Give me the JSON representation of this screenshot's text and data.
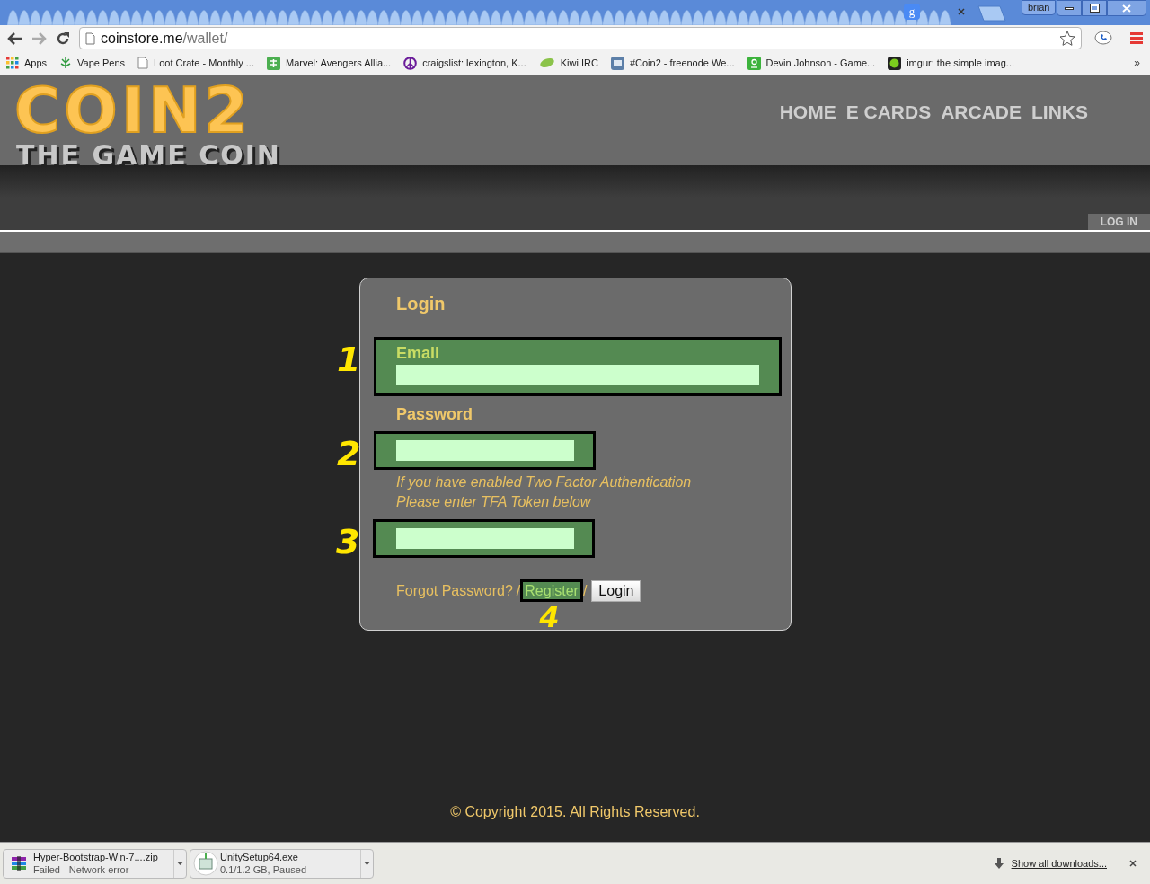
{
  "browser": {
    "tab_favicon": "g",
    "profile": "brian",
    "url": {
      "host": "coinstore.me",
      "path": "/wallet/"
    },
    "bookmarks": [
      {
        "kind": "grid",
        "label": "Apps"
      },
      {
        "kind": "leaf",
        "label": "Vape Pens"
      },
      {
        "kind": "page",
        "label": "Loot Crate - Monthly ..."
      },
      {
        "kind": "tile",
        "label": "Marvel: Avengers Allia..."
      },
      {
        "kind": "peace",
        "label": "craigslist: lexington, K..."
      },
      {
        "kind": "kiwi",
        "label": "Kiwi IRC"
      },
      {
        "kind": "irc",
        "label": "#Coin2 - freenode We..."
      },
      {
        "kind": "person",
        "label": "Devin Johnson - Game..."
      },
      {
        "kind": "dot",
        "label": "imgur: the simple imag..."
      }
    ],
    "more": "»"
  },
  "site": {
    "logo": {
      "title": "COIN2",
      "subtitle": "THE GAME COIN"
    },
    "nav": [
      {
        "label": "HOME"
      },
      {
        "label": "E CARDS"
      },
      {
        "label": "ARCADE"
      },
      {
        "label": "LINKS"
      }
    ],
    "login_tab": "LOG IN"
  },
  "login": {
    "title": "Login",
    "fields": [
      {
        "kind": "email",
        "label": "Email",
        "annotation": "1"
      },
      {
        "kind": "password",
        "label": "Password",
        "annotation": "2"
      },
      {
        "kind": "token",
        "note": [
          "If you have enabled Two Factor Authentication",
          "Please enter TFA Token below"
        ],
        "annotation": "3"
      }
    ],
    "forgot": "Forgot Password?",
    "separator": "/",
    "register": "Register",
    "register_annotation": "4",
    "login_button": "Login"
  },
  "footer": "© Copyright 2015. All Rights Reserved.",
  "downloads": [
    {
      "kind": "archive",
      "name": "Hyper-Bootstrap-Win-7....zip",
      "status": "Failed - Network error"
    },
    {
      "kind": "installer",
      "name": "UnitySetup64.exe",
      "status": "0.1/1.2 GB, Paused"
    }
  ],
  "show_all": "Show all downloads..."
}
